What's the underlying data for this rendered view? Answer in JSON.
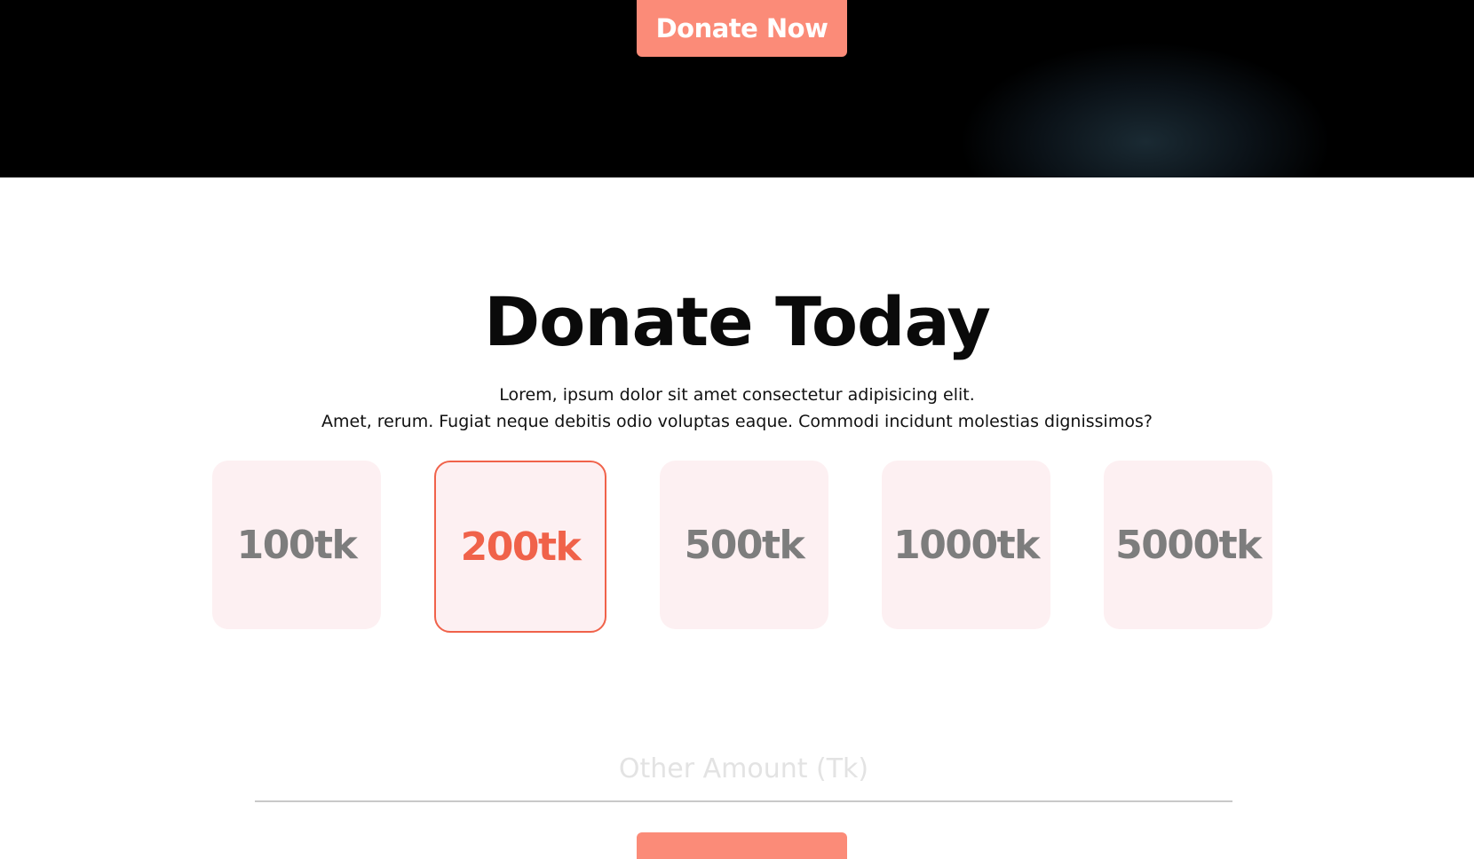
{
  "hero": {
    "donate_button_label": "Donate Now"
  },
  "section": {
    "title": "Donate Today",
    "subtitle_line1": "Lorem, ipsum dolor sit amet consectetur adipisicing elit.",
    "subtitle_line2": "Amet, rerum. Fugiat neque debitis odio voluptas eaque. Commodi incidunt molestias dignissimos?"
  },
  "amounts": [
    {
      "label": "100tk",
      "selected": false
    },
    {
      "label": "200tk",
      "selected": true
    },
    {
      "label": "500tk",
      "selected": false
    },
    {
      "label": "1000tk",
      "selected": false
    },
    {
      "label": "5000tk",
      "selected": false
    }
  ],
  "other_amount": {
    "placeholder": "Other Amount (Tk)",
    "value": ""
  },
  "colors": {
    "accent": "#fb8b78",
    "selected": "#f0624a",
    "card_bg": "#fdf0f2",
    "card_text": "#7d7d7d"
  }
}
